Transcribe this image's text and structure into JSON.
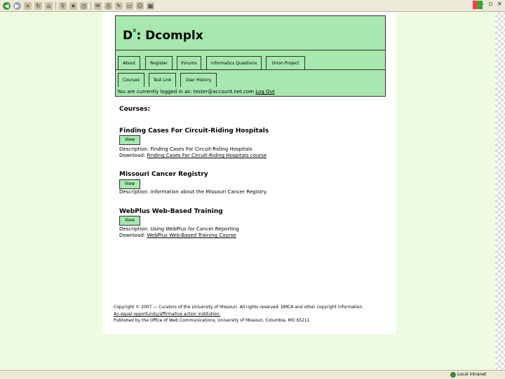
{
  "browser": {
    "toolbar_icons": [
      "back-icon",
      "forward-icon",
      "close-page-icon",
      "refresh-icon",
      "home-icon",
      "search-icon",
      "favorites-icon",
      "history-icon",
      "mail-icon",
      "print-icon",
      "edit-icon",
      "folder-icon",
      "messenger-icon",
      "research-icon"
    ],
    "window_controls": [
      "–",
      "▫",
      "×"
    ],
    "status_zone": "Local intranet"
  },
  "site": {
    "logo_prefix": "D",
    "logo_sup": "x",
    "logo_text": ": Dcomplx"
  },
  "nav": {
    "row1": [
      "About",
      "Register",
      "Forums",
      "Informatics Questions",
      "Orion Project"
    ],
    "row2": [
      "Courses",
      "Test Link",
      "User History"
    ]
  },
  "login": {
    "prefix": "You are currently logged in as: ",
    "email": "tester@account.net.com",
    "logout": "Log Out"
  },
  "courses": {
    "heading": "Courses:",
    "view_label": "View",
    "items": [
      {
        "title": "Finding Cases For Circuit-Riding Hospitals",
        "description_label": "Description:",
        "description": "Finding Cases For Circuit-Riding Hospitals",
        "download_label": "Download:",
        "download": "Finding Cases For Circuit-Riding Hospitals course"
      },
      {
        "title": "Missouri Cancer Registry",
        "description_label": "Description:",
        "description": "Information about the Missouri Cancer Registry."
      },
      {
        "title": "WebPlus Web-Based Training",
        "description_label": "Description:",
        "description": "Using WebPlus for Cancer Reporting",
        "download_label": "Download:",
        "download": "WebPlus Web-Based Training Course"
      }
    ]
  },
  "footer": {
    "line1": "Copyright © 2007 — Curators of the University of Missouri. All rights reserved. DMCA and other copyright information.",
    "line2": "An equal opportunity/affirmative action institution.",
    "line3": "Published by the Office of Web Communications, University of Missouri, Columbia, MO 65211"
  }
}
